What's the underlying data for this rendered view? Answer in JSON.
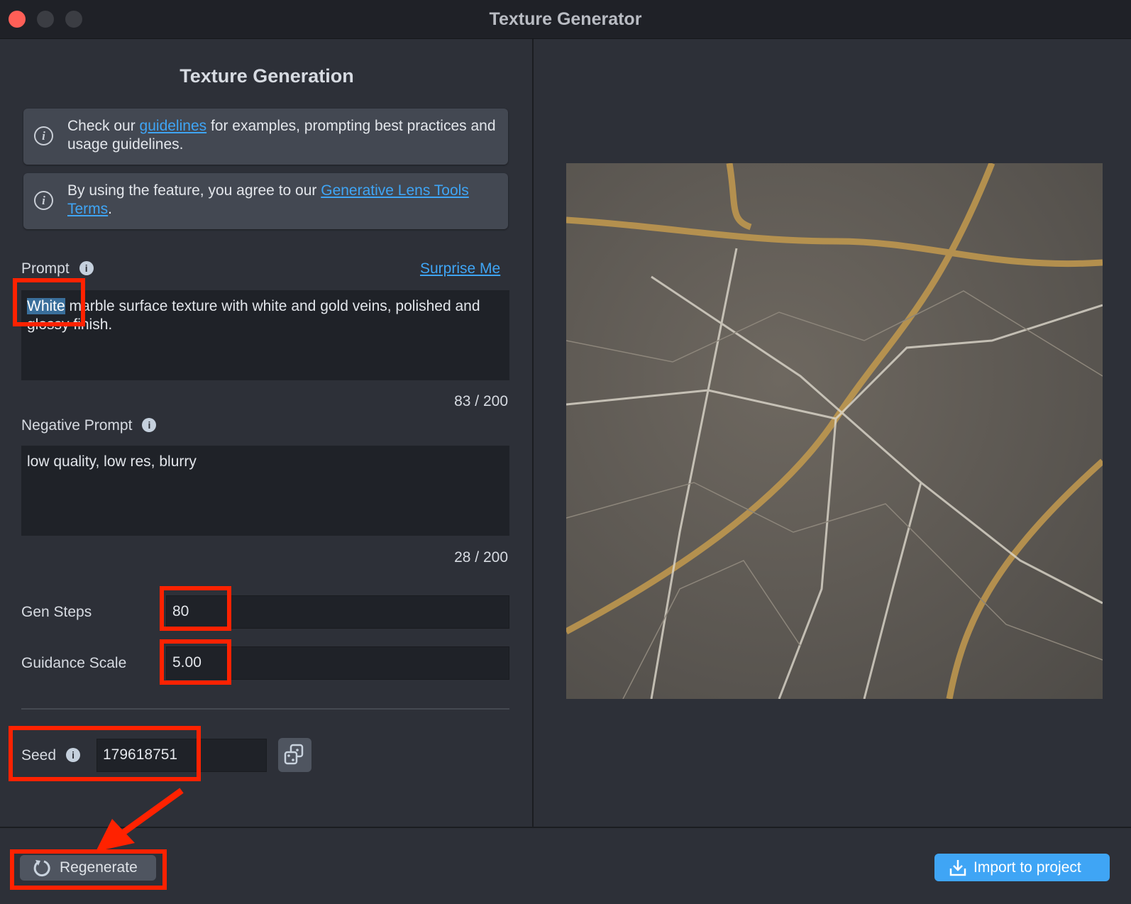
{
  "window": {
    "title": "Texture Generator"
  },
  "panel": {
    "heading": "Texture Generation"
  },
  "info1": {
    "pre": "Check our ",
    "link": "guidelines",
    "post": " for examples, prompting best practices and usage guidelines."
  },
  "info2": {
    "pre": "By using the feature, you agree to our ",
    "link": "Generative Lens Tools Terms",
    "post": "."
  },
  "prompt": {
    "label": "Prompt",
    "surprise": "Surprise Me",
    "selected": "White",
    "value": " marble surface texture with white and gold veins, polished and glossy finish.",
    "count": "83 / 200"
  },
  "negative": {
    "label": "Negative Prompt",
    "value": "low quality, low res, blurry",
    "count": "28 / 200"
  },
  "gen_steps": {
    "label": "Gen Steps",
    "value": "80"
  },
  "guidance": {
    "label": "Guidance Scale",
    "value": "5.00"
  },
  "seed": {
    "label": "Seed",
    "value": "179618751"
  },
  "buttons": {
    "regenerate": "Regenerate",
    "import": "Import to project"
  },
  "colors": {
    "accent": "#3fa5f5",
    "annotation": "#ff2200"
  }
}
